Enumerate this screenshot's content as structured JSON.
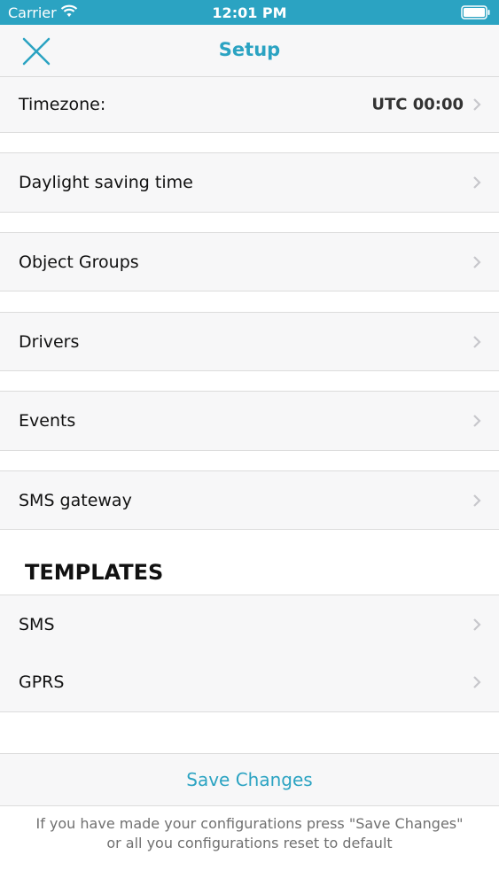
{
  "status_bar": {
    "carrier": "Carrier",
    "time": "12:01 PM"
  },
  "nav": {
    "title": "Setup",
    "accent_color": "#2ba3c2"
  },
  "settings": {
    "timezone": {
      "label": "Timezone:",
      "value": "UTC 00:00"
    },
    "daylight_saving": {
      "label": "Daylight saving time"
    },
    "object_groups": {
      "label": "Object Groups"
    },
    "drivers": {
      "label": "Drivers"
    },
    "events": {
      "label": "Events"
    },
    "sms_gateway": {
      "label": "SMS gateway"
    }
  },
  "templates": {
    "header": "TEMPLATES",
    "sms": {
      "label": "SMS"
    },
    "gprs": {
      "label": "GPRS"
    }
  },
  "save": {
    "label": "Save Changes",
    "note_line1": "If you have made your configurations press \"Save Changes\"",
    "note_line2": "or all you configurations reset to default"
  },
  "icons": {
    "close": "close-icon",
    "chevron": "chevron-right-icon",
    "wifi": "wifi-icon",
    "battery": "battery-icon"
  }
}
